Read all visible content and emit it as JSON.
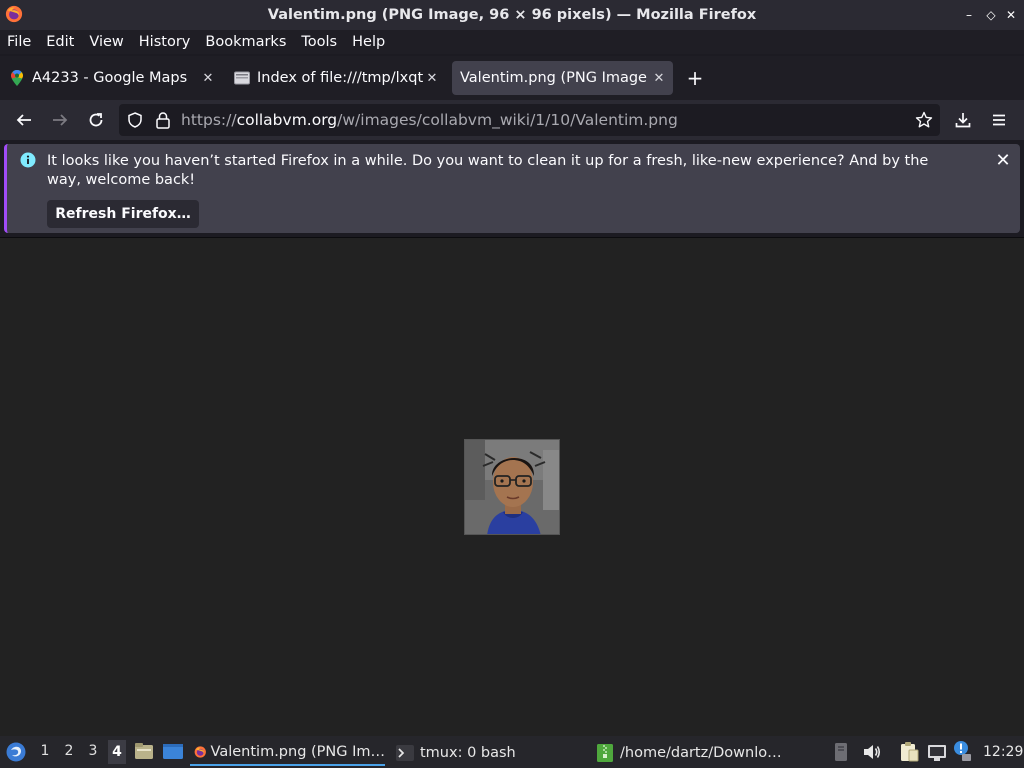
{
  "window": {
    "title": "Valentim.png (PNG Image, 96 × 96 pixels) — Mozilla Firefox",
    "min": "–",
    "max": "◇",
    "close": "✕"
  },
  "menu": {
    "file": "File",
    "edit": "Edit",
    "view": "View",
    "history": "History",
    "bookmarks": "Bookmarks",
    "tools": "Tools",
    "help": "Help"
  },
  "tabs": [
    {
      "label": "A4233 - Google Maps",
      "icon": "map-pin-icon"
    },
    {
      "label": "Index of file:///tmp/lxqt",
      "icon": "folder-file-icon"
    },
    {
      "label": "Valentim.png (PNG Image",
      "icon": "image-icon"
    }
  ],
  "tab_close": "✕",
  "new_tab": "+",
  "url": {
    "scheme": "https://",
    "host": "collabvm.org",
    "path": "/w/images/collabvm_wiki/1/10/Valentim.png"
  },
  "notice": {
    "message": "It looks like you haven’t started Firefox in a while. Do you want to clean it up for a fresh, like-new experience? And by the way, welcome back!",
    "button_label": "Refresh Firefox…"
  },
  "taskbar": {
    "workspaces": [
      "1",
      "2",
      "3",
      "4"
    ],
    "active_workspace": "4",
    "tasks": {
      "firefox": "Valentim.png (PNG Im…",
      "tmux": "tmux: 0 bash",
      "files": "/home/dartz/Downlo…"
    },
    "clock": "12:29"
  },
  "colors": {
    "accent": "#a14cf7",
    "info": "#80ebff",
    "taskbar_active": "#4aa2e8"
  }
}
